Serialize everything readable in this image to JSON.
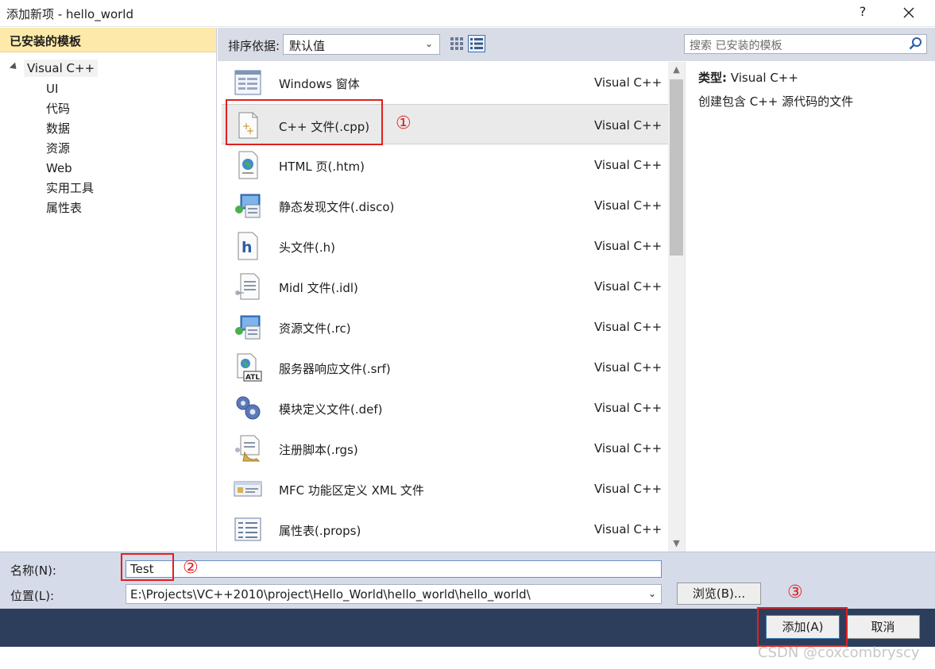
{
  "window": {
    "title": "添加新项 - hello_world",
    "help_label": "?"
  },
  "left": {
    "header": "已安装的模板",
    "tree_root": "Visual C++",
    "tree_children": [
      "UI",
      "代码",
      "数据",
      "资源",
      "Web",
      "实用工具",
      "属性表"
    ]
  },
  "toolbar": {
    "sort_label": "排序依据:",
    "sort_value": "默认值",
    "search_placeholder": "搜索 已安装的模板"
  },
  "templates": [
    {
      "name": "Windows 窗体",
      "lang": "Visual C++",
      "icon": "windows-form-icon"
    },
    {
      "name": "C++ 文件(.cpp)",
      "lang": "Visual C++",
      "icon": "cpp-file-icon"
    },
    {
      "name": "HTML 页(.htm)",
      "lang": "Visual C++",
      "icon": "html-page-icon"
    },
    {
      "name": "静态发现文件(.disco)",
      "lang": "Visual C++",
      "icon": "disco-file-icon"
    },
    {
      "name": "头文件(.h)",
      "lang": "Visual C++",
      "icon": "header-file-icon"
    },
    {
      "name": "Midl 文件(.idl)",
      "lang": "Visual C++",
      "icon": "idl-file-icon"
    },
    {
      "name": "资源文件(.rc)",
      "lang": "Visual C++",
      "icon": "resource-file-icon"
    },
    {
      "name": "服务器响应文件(.srf)",
      "lang": "Visual C++",
      "icon": "srf-file-icon"
    },
    {
      "name": "模块定义文件(.def)",
      "lang": "Visual C++",
      "icon": "def-file-icon"
    },
    {
      "name": "注册脚本(.rgs)",
      "lang": "Visual C++",
      "icon": "rgs-file-icon"
    },
    {
      "name": "MFC 功能区定义 XML 文件",
      "lang": "Visual C++",
      "icon": "ribbon-xml-icon"
    },
    {
      "name": "属性表(.props)",
      "lang": "Visual C++",
      "icon": "props-file-icon"
    }
  ],
  "description": {
    "type_label": "类型:",
    "type_value": "Visual C++",
    "text": "创建包含 C++ 源代码的文件"
  },
  "form": {
    "name_label": "名称(N):",
    "name_value": "Test",
    "location_label": "位置(L):",
    "location_value": "E:\\Projects\\VC++2010\\project\\Hello_World\\hello_world\\hello_world\\",
    "browse_label": "浏览(B)..."
  },
  "buttons": {
    "add_label": "添加(A)",
    "cancel_label": "取消"
  },
  "annotations": [
    "①",
    "②",
    "③"
  ],
  "watermark": "CSDN @coxcombryscy",
  "colors": {
    "annotation_red": "#e02020",
    "footer_navy": "#2d3e5c",
    "header_yellow": "#fde9a9"
  }
}
